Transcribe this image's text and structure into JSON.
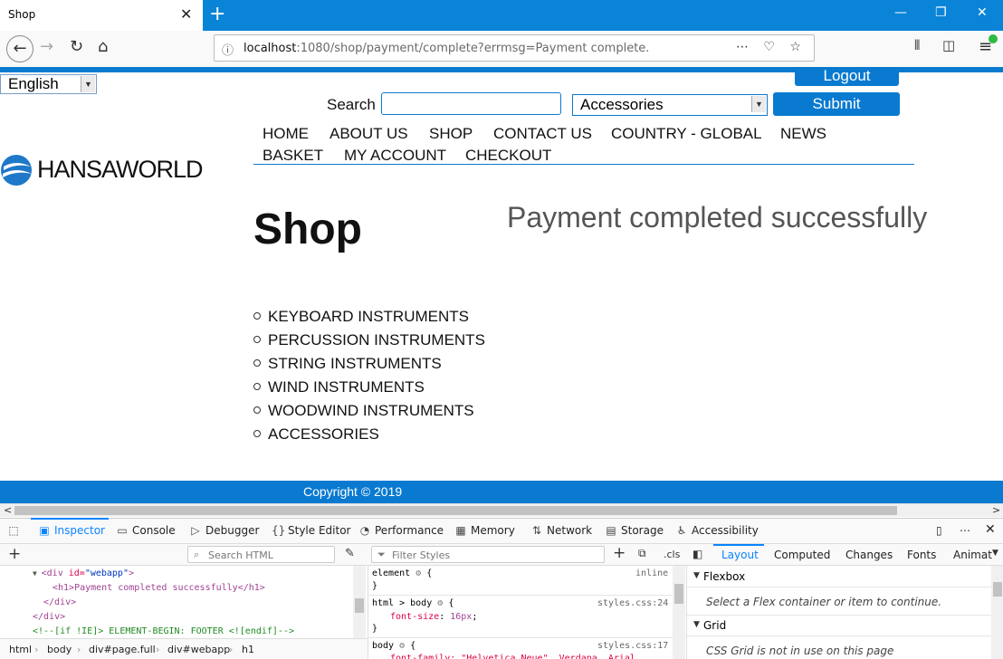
{
  "browser": {
    "tab_title": "Shop",
    "url_host": "localhost",
    "url_rest": ":1080/shop/payment/complete?errmsg=Payment complete."
  },
  "page": {
    "language": "English",
    "logout_label": "Logout",
    "search_label": "Search",
    "search_value": "",
    "category_selected": "Accessories",
    "submit_label": "Submit",
    "menu": [
      "HOME",
      "ABOUT US",
      "SHOP",
      "CONTACT US",
      "COUNTRY - GLOBAL",
      "NEWS",
      "BASKET",
      "MY ACCOUNT",
      "CHECKOUT"
    ],
    "logo_text": "HANSAWORLD",
    "heading": "Shop",
    "message": "Payment completed successfully",
    "categories": [
      "KEYBOARD INSTRUMENTS",
      "PERCUSSION INSTRUMENTS",
      "STRING INSTRUMENTS",
      "WIND INSTRUMENTS",
      "WOODWIND INSTRUMENTS",
      "ACCESSORIES"
    ],
    "footer": "Copyright © 2019"
  },
  "devtools": {
    "tabs": [
      "Inspector",
      "Console",
      "Debugger",
      "Style Editor",
      "Performance",
      "Memory",
      "Network",
      "Storage",
      "Accessibility"
    ],
    "search_html_placeholder": "Search HTML",
    "filter_styles_placeholder": "Filter Styles",
    "cls_label": ".cls",
    "side_tabs": [
      "Layout",
      "Computed",
      "Changes",
      "Fonts",
      "Animat"
    ],
    "html_lines": {
      "l1_open": "<div ",
      "l1_attr": "id=",
      "l1_val": "\"webapp\"",
      "l1_close": ">",
      "l2": "<h1>Payment completed successfully</h1>",
      "l3": "</div>",
      "l4": "<!--[if !IE]> ELEMENT-BEGIN: FOOTER <![endif]-->"
    },
    "breadcrumbs": [
      "html",
      "body",
      "div#page.full",
      "div#webapp",
      "h1"
    ],
    "rules": {
      "r1_sel": "element",
      "r1_src": "inline",
      "r2_sel": "html > body",
      "r2_src": "styles.css:24",
      "r2_prop": "font-size",
      "r2_val": "16px",
      "r3_sel": "body",
      "r3_src": "styles.css:17",
      "r3_partial": "font-family: \"Helvetica Neue\", Verdana, Arial"
    },
    "layout": {
      "flexbox_title": "Flexbox",
      "flexbox_msg": "Select a Flex container or item to continue.",
      "grid_title": "Grid",
      "grid_msg": "CSS Grid is not in use on this page"
    }
  },
  "colors": {
    "accent": "#0a7ad0",
    "titlebar": "#0a84d6"
  }
}
